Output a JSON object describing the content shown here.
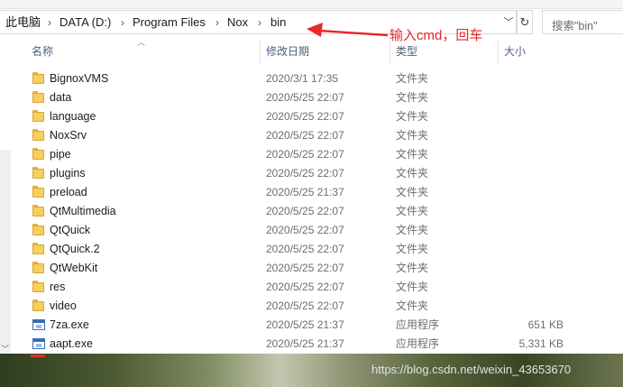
{
  "window": {
    "breadcrumb": [
      "此电脑",
      "DATA (D:)",
      "Program Files",
      "Nox",
      "bin"
    ],
    "search_placeholder": "搜索\"bin\""
  },
  "annotation": {
    "text": "输入cmd，回车",
    "color": "#e8282b"
  },
  "columns": {
    "name": "名称",
    "date": "修改日期",
    "type": "类型",
    "size": "大小"
  },
  "files": [
    {
      "name": "BignoxVMS",
      "date": "2020/3/1 17:35",
      "type": "文件夹",
      "size": "",
      "icon": "folder-icon"
    },
    {
      "name": "data",
      "date": "2020/5/25 22:07",
      "type": "文件夹",
      "size": "",
      "icon": "folder-icon"
    },
    {
      "name": "language",
      "date": "2020/5/25 22:07",
      "type": "文件夹",
      "size": "",
      "icon": "folder-icon"
    },
    {
      "name": "NoxSrv",
      "date": "2020/5/25 22:07",
      "type": "文件夹",
      "size": "",
      "icon": "folder-icon"
    },
    {
      "name": "pipe",
      "date": "2020/5/25 22:07",
      "type": "文件夹",
      "size": "",
      "icon": "folder-icon"
    },
    {
      "name": "plugins",
      "date": "2020/5/25 22:07",
      "type": "文件夹",
      "size": "",
      "icon": "folder-icon"
    },
    {
      "name": "preload",
      "date": "2020/5/25 21:37",
      "type": "文件夹",
      "size": "",
      "icon": "folder-icon"
    },
    {
      "name": "QtMultimedia",
      "date": "2020/5/25 22:07",
      "type": "文件夹",
      "size": "",
      "icon": "folder-icon"
    },
    {
      "name": "QtQuick",
      "date": "2020/5/25 22:07",
      "type": "文件夹",
      "size": "",
      "icon": "folder-icon"
    },
    {
      "name": "QtQuick.2",
      "date": "2020/5/25 22:07",
      "type": "文件夹",
      "size": "",
      "icon": "folder-icon"
    },
    {
      "name": "QtWebKit",
      "date": "2020/5/25 22:07",
      "type": "文件夹",
      "size": "",
      "icon": "folder-icon"
    },
    {
      "name": "res",
      "date": "2020/5/25 22:07",
      "type": "文件夹",
      "size": "",
      "icon": "folder-icon"
    },
    {
      "name": "video",
      "date": "2020/5/25 22:07",
      "type": "文件夹",
      "size": "",
      "icon": "folder-icon"
    },
    {
      "name": "7za.exe",
      "date": "2020/5/25 21:37",
      "type": "应用程序",
      "size": "651 KB",
      "icon": "exe-icon"
    },
    {
      "name": "aapt.exe",
      "date": "2020/5/25 21:37",
      "type": "应用程序",
      "size": "5,331 KB",
      "icon": "exe-icon"
    }
  ],
  "watermark": "https://blog.csdn.net/weixin_43653670"
}
